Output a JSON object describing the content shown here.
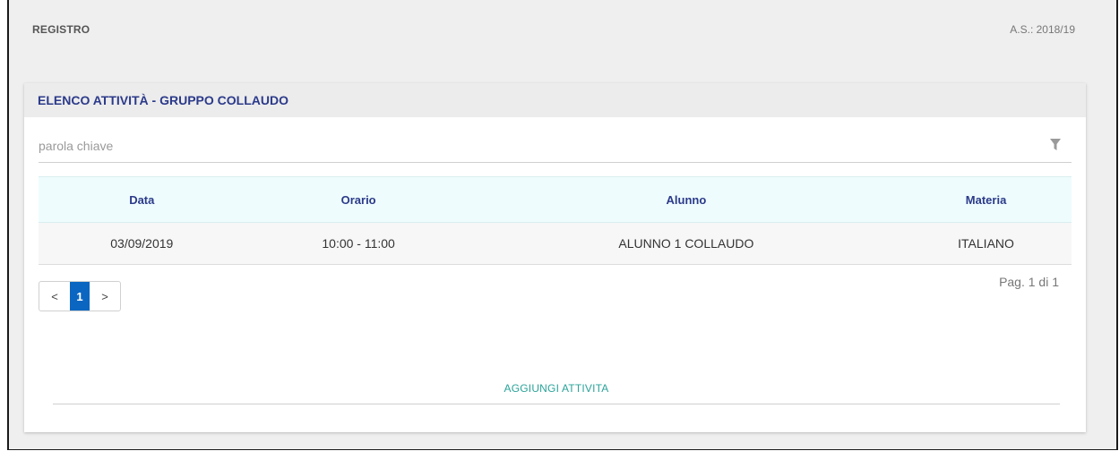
{
  "header": {
    "title": "REGISTRO",
    "school_year": "A.S.: 2018/19"
  },
  "card": {
    "title": "ELENCO ATTIVITÀ - GRUPPO COLLAUDO"
  },
  "search": {
    "placeholder": "parola chiave",
    "value": "",
    "icon": "filter-icon"
  },
  "table": {
    "columns": [
      "Data",
      "Orario",
      "Alunno",
      "Materia"
    ],
    "rows": [
      [
        "03/09/2019",
        "10:00 - 11:00",
        "ALUNNO 1 COLLAUDO",
        "ITALIANO"
      ]
    ]
  },
  "pagination": {
    "prev_label": "<",
    "current_page": "1",
    "next_label": ">",
    "info": "Pag. 1 di 1"
  },
  "actions": {
    "add_label": "AGGIUNGI ATTIVITA"
  },
  "colors": {
    "accent_blue": "#0b66c2",
    "header_text": "#2b3a8a",
    "action_teal": "#2aa39a"
  }
}
